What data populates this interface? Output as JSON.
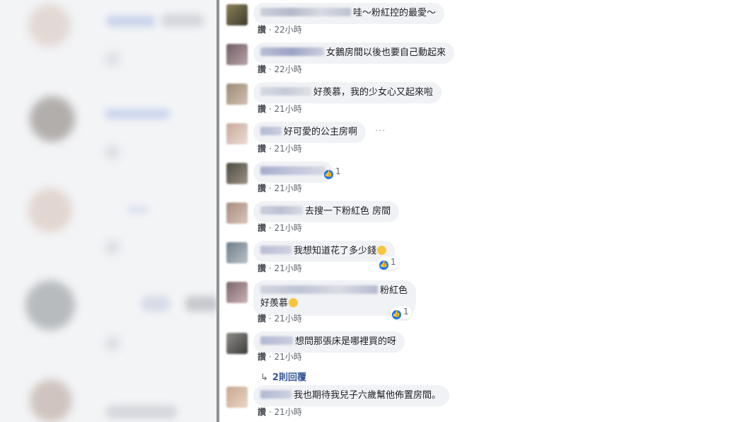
{
  "comments": [
    {
      "text": "哇～粉紅控的最愛～",
      "meta_like": "讚",
      "meta_time": "22小時"
    },
    {
      "text": "女鵝房間以後也要自己動起來",
      "meta_like": "讚",
      "meta_time": "22小時"
    },
    {
      "text": "好羨慕，我的少女心又起來啦",
      "meta_like": "讚",
      "meta_time": "21小時"
    },
    {
      "text": "好可愛的公主房啊",
      "meta_like": "讚",
      "meta_time": "21小時"
    },
    {
      "text": "",
      "meta_like": "讚",
      "meta_time": "21小時",
      "reaction": "1"
    },
    {
      "text": "去搜一下粉紅色 房間",
      "meta_like": "讚",
      "meta_time": "21小時"
    },
    {
      "text": "我想知道花了多少錢",
      "meta_like": "讚",
      "meta_time": "21小時",
      "reaction": "1"
    },
    {
      "text": "粉紅色",
      "text2": "好羨慕",
      "meta_like": "讚",
      "meta_time": "21小時",
      "reaction": "1"
    },
    {
      "text": "想問那張床是哪裡買的呀",
      "meta_like": "讚",
      "meta_time": "21小時"
    },
    {
      "text": "我也期待我兒子六歲幫他佈置房間。",
      "meta_like": "讚",
      "meta_time": "21小時"
    }
  ],
  "replies_link": "2則回覆",
  "more_options": "···",
  "meta_separator": "·",
  "colors": {
    "bubble": "#f0f2f5",
    "link": "#365899",
    "like_blue": "#1877f2"
  }
}
